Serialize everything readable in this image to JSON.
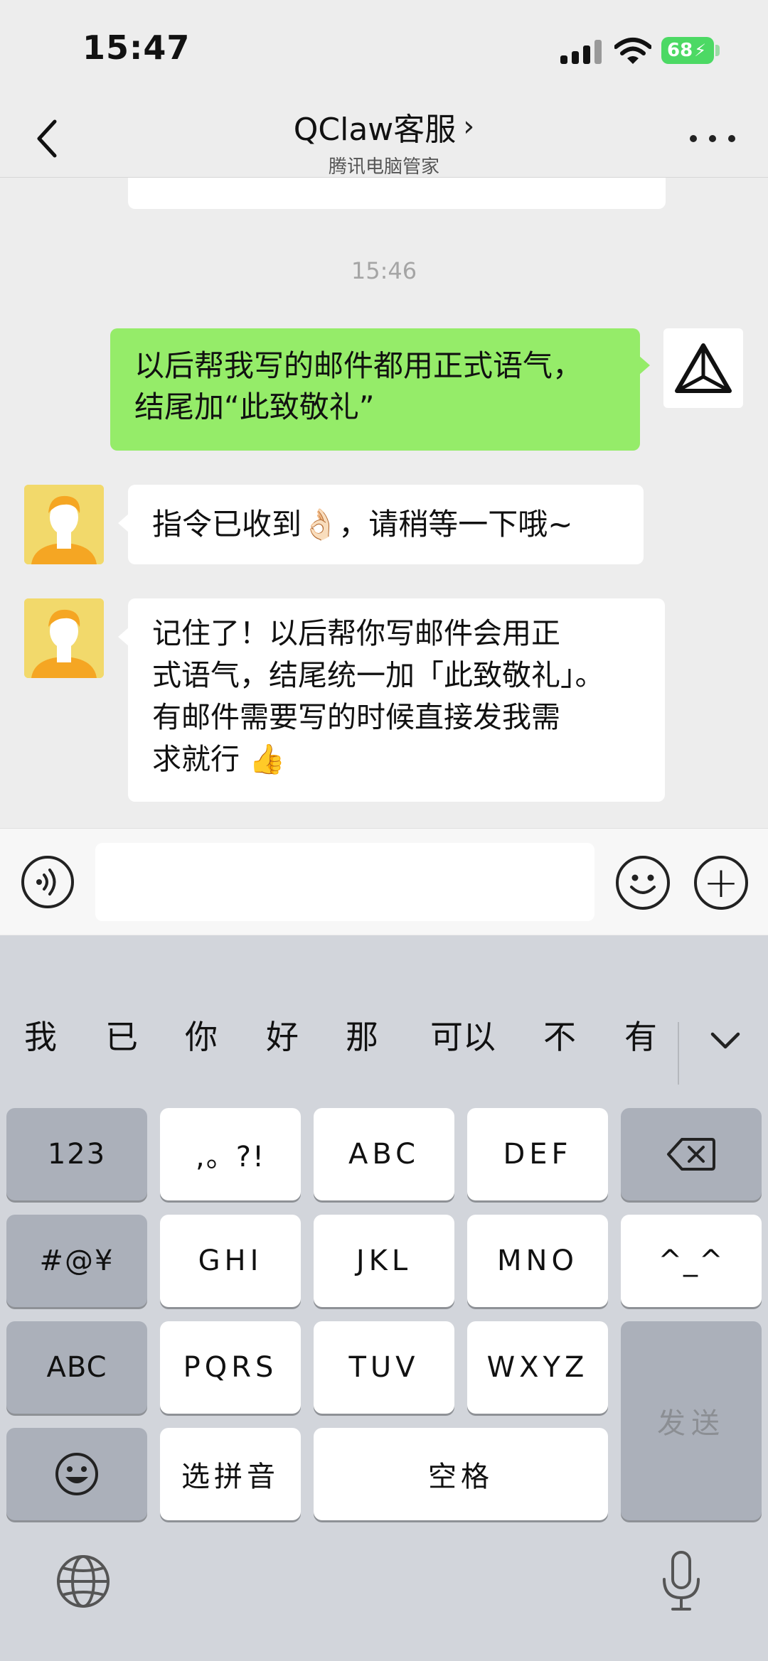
{
  "status_bar": {
    "time": "15:47",
    "battery": "68"
  },
  "nav": {
    "title": "QClaw客服",
    "title_chevron": "›",
    "subtitle": "腾讯电脑管家"
  },
  "chat": {
    "timestamp": "15:46",
    "messages": [
      {
        "sender": "me",
        "lines": [
          "以后帮我写的邮件都用正式语气，",
          "结尾加“此致敬礼”"
        ]
      },
      {
        "sender": "bot",
        "lines": [
          "指令已收到👌🏻，请稍等一下哦~"
        ]
      },
      {
        "sender": "bot",
        "lines": [
          "记住了！以后帮你写邮件会用正",
          "式语气，结尾统一加「此致敬礼」。",
          "有邮件需要写的时候直接发我需",
          "求就行 👍"
        ]
      }
    ]
  },
  "input_bar": {
    "value": "",
    "plus_label": "+"
  },
  "keyboard": {
    "candidates": [
      "我",
      "已",
      "你",
      "好",
      "那",
      "可以",
      "不",
      "有"
    ],
    "keys": {
      "numbers": "123",
      "punct": ",。?!",
      "abc": "ABC",
      "def": "DEF",
      "symbols": "#@¥",
      "ghi": "GHI",
      "jkl": "JKL",
      "mno": "MNO",
      "kaomoji": "^_^",
      "abc_mode": "ABC",
      "pqrs": "PQRS",
      "tuv": "TUV",
      "wxyz": "WXYZ",
      "send": "发送",
      "pinyin": "选拼音",
      "space": "空格"
    }
  },
  "colors": {
    "accent_green": "#95ec69",
    "caret": "#07c160",
    "background": "#ededed"
  }
}
